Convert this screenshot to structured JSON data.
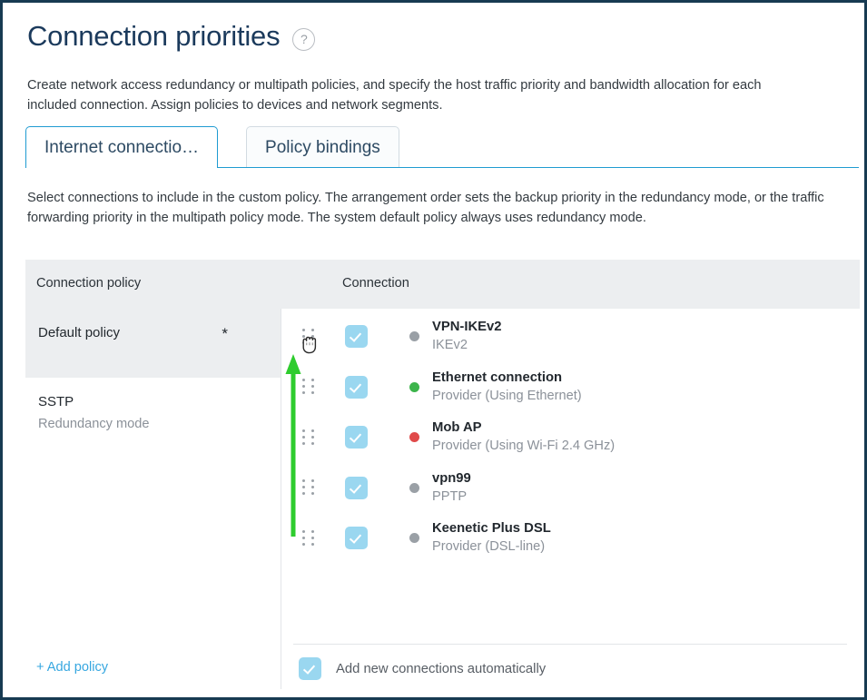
{
  "page": {
    "title": "Connection priorities",
    "help_icon": "question-circle-icon",
    "description": "Create network access redundancy or multipath policies, and specify the host traffic priority and bandwidth allocation for each included connection. Assign policies to devices and network segments.",
    "sub_description": "Select connections to include in the custom policy. The arrangement order sets the backup priority in the redundancy mode, or the traffic forwarding priority in the multipath policy mode. The system default policy always uses redundancy mode."
  },
  "tabs": [
    {
      "label": "Internet connectio…",
      "active": true
    },
    {
      "label": "Policy bindings",
      "active": false
    }
  ],
  "table": {
    "headers": {
      "policy": "Connection policy",
      "connection": "Connection"
    }
  },
  "policies": {
    "items": [
      {
        "name": "Default policy",
        "mode": "",
        "star": "*",
        "selected": true
      },
      {
        "name": "SSTP",
        "mode": "Redundancy mode",
        "star": "",
        "selected": false
      }
    ],
    "add_label": "+ Add policy"
  },
  "connections": {
    "items": [
      {
        "name": "VPN-IKEv2",
        "sub": "IKEv2",
        "status": "grey",
        "checked": true
      },
      {
        "name": "Ethernet connection",
        "sub": "Provider (Using Ethernet)",
        "status": "green",
        "checked": true
      },
      {
        "name": "Mob AP",
        "sub": "Provider (Using Wi-Fi 2.4 GHz)",
        "status": "red",
        "checked": true
      },
      {
        "name": "vpn99",
        "sub": "PPTP",
        "status": "grey",
        "checked": true
      },
      {
        "name": "Keenetic Plus DSL",
        "sub": "Provider (DSL-line)",
        "status": "grey",
        "checked": true
      }
    ],
    "auto_add": {
      "label": "Add new connections automatically",
      "checked": true
    }
  },
  "colors": {
    "frame": "#173a52",
    "title": "#1b3a5c",
    "accent": "#1f9bd1",
    "link": "#36a7e0",
    "checkbox": "#9ad7f0",
    "header_bg": "#eceef0",
    "status_grey": "#9aa0a6",
    "status_green": "#3cb44b",
    "status_red": "#e04a4a",
    "annotation_green": "#2ecc2e"
  },
  "annotations": {
    "arrow": "up-arrow-annotation",
    "cursor": "grab-hand-cursor"
  }
}
